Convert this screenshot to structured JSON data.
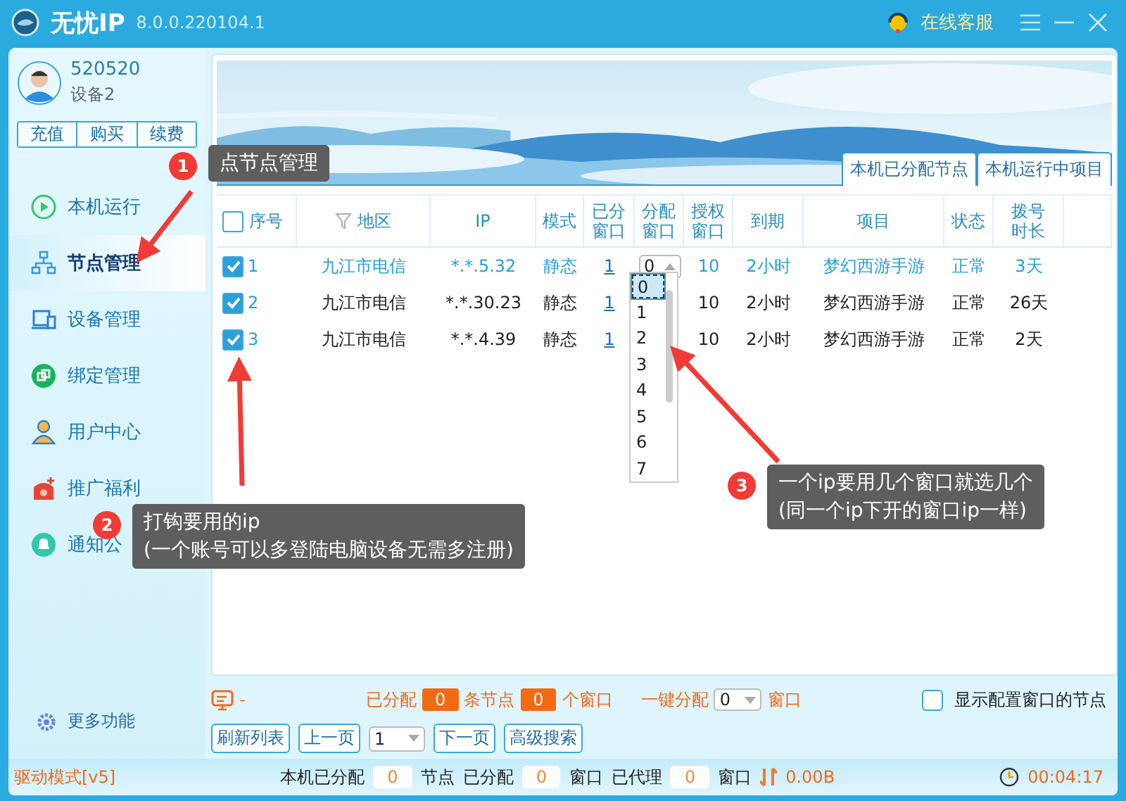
{
  "window": {
    "title": "无忧IP",
    "version": "8.0.0.220104.1",
    "service": "在线客服"
  },
  "user": {
    "name": "520520",
    "device": "设备2",
    "buttons": [
      "充值",
      "购买",
      "续费"
    ]
  },
  "nav": [
    {
      "label": "本机运行",
      "kind": "play",
      "selected": false
    },
    {
      "label": "节点管理",
      "kind": "tree",
      "selected": true
    },
    {
      "label": "设备管理",
      "kind": "device",
      "selected": false
    },
    {
      "label": "绑定管理",
      "kind": "bind",
      "selected": false
    },
    {
      "label": "用户中心",
      "kind": "user",
      "selected": false
    },
    {
      "label": "推广福利",
      "kind": "gift",
      "selected": false
    },
    {
      "label": "通知公",
      "kind": "bell",
      "selected": false
    }
  ],
  "more": "更多功能",
  "tabs": [
    "本机已分配节点",
    "本机运行中项目"
  ],
  "table": {
    "header_checked": false,
    "columns": [
      "序号",
      "地区",
      "IP",
      "模式",
      "已分窗口",
      "分配窗口",
      "授权窗口",
      "到期",
      "项目",
      "状态",
      "拨号时长"
    ],
    "rows": [
      {
        "checked": true,
        "selected": true,
        "no": "1",
        "region": "九江市电信",
        "ip": "*.*.5.32",
        "mode": "静态",
        "assigned": "1",
        "alloc": "0",
        "auth": "10",
        "expire": "2小时",
        "project": "梦幻西游手游",
        "status": "正常",
        "dial": "3天"
      },
      {
        "checked": true,
        "selected": false,
        "no": "2",
        "region": "九江市电信",
        "ip": "*.*.30.23",
        "mode": "静态",
        "assigned": "1",
        "auth": "10",
        "expire": "2小时",
        "project": "梦幻西游手游",
        "status": "正常",
        "dial": "26天"
      },
      {
        "checked": true,
        "selected": false,
        "no": "3",
        "region": "九江市电信",
        "ip": "*.*.4.39",
        "mode": "静态",
        "assigned": "1",
        "auth": "10",
        "expire": "2小时",
        "project": "梦幻西游手游",
        "status": "正常",
        "dial": "2天"
      }
    ]
  },
  "dropdown": {
    "options": [
      {
        "label": "0",
        "selected": true
      },
      {
        "label": "1",
        "selected": false
      },
      {
        "label": "2",
        "selected": false
      },
      {
        "label": "3",
        "selected": false
      },
      {
        "label": "4",
        "selected": false
      },
      {
        "label": "5",
        "selected": false
      },
      {
        "label": "6",
        "selected": false
      },
      {
        "label": "7",
        "selected": false
      }
    ]
  },
  "summary": {
    "dash": "-",
    "assigned_label": "已分配",
    "nodes": "0",
    "nodes_label": "条节点",
    "windows": "0",
    "windows_label": "个窗口",
    "one_key_label": "一键分配",
    "one_key": "0",
    "one_key_unit": "窗口",
    "show_config": {
      "label": "显示配置窗口的节点",
      "checked": false
    }
  },
  "toolbar": {
    "refresh": "刷新列表",
    "prev": "上一页",
    "page": "1",
    "next": "下一页",
    "search": "高级搜索"
  },
  "status_bar": {
    "mode": "驱动模式[v5]",
    "local_label": "本机已分配",
    "local": "0",
    "local_unit": "节点",
    "assigned_label": "已分配",
    "assigned": "0",
    "assigned_unit": "窗口",
    "proxy_label": "已代理",
    "proxy": "0",
    "proxy_unit": "窗口",
    "traffic": "0.00B",
    "time": "00:04:17"
  },
  "callouts": [
    {
      "number": "1",
      "lines": [
        "点节点管理"
      ]
    },
    {
      "number": "2",
      "lines": [
        "打钩要用的ip",
        "(一个账号可以多登陆电脑设备无需多注册)"
      ]
    },
    {
      "number": "3",
      "lines": [
        "一个ip要用几个窗口就选几个",
        "(同一个ip下开的窗口ip一样)"
      ]
    }
  ]
}
